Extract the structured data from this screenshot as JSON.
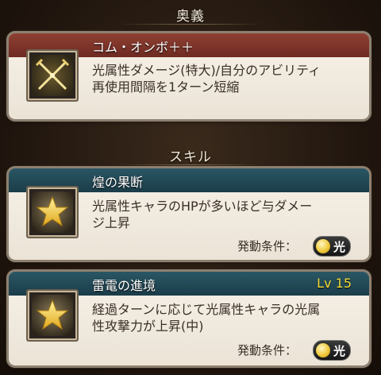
{
  "sections": {
    "ougi_header": "奥義",
    "skill_header": "スキル"
  },
  "ougi": {
    "title": "コム・オンボ＋＋",
    "description_line1": "光属性ダメージ(特大)/自分のアビリティ",
    "description_line2": "再使用間隔を1ターン短縮",
    "icon": "crossed-swords-icon"
  },
  "skills": [
    {
      "title": "煌の果断",
      "description_line1": "光属性キャラのHPが多いほど与ダメー",
      "description_line2": "ジ上昇",
      "condition_label": "発動条件：",
      "element": "光",
      "icon": "star-icon"
    },
    {
      "title": "雷電の進境",
      "level": "Lv 15",
      "description_line1": "経過ターンに応じて光属性キャラの光属",
      "description_line2": "性攻撃力が上昇(中)",
      "condition_label": "発動条件：",
      "element": "光",
      "icon": "star-icon"
    }
  ],
  "colors": {
    "ougi_bar": "#7e3529",
    "skill_bar": "#234a57",
    "level_text": "#f2dc38",
    "element_light": "#f0c93a"
  }
}
